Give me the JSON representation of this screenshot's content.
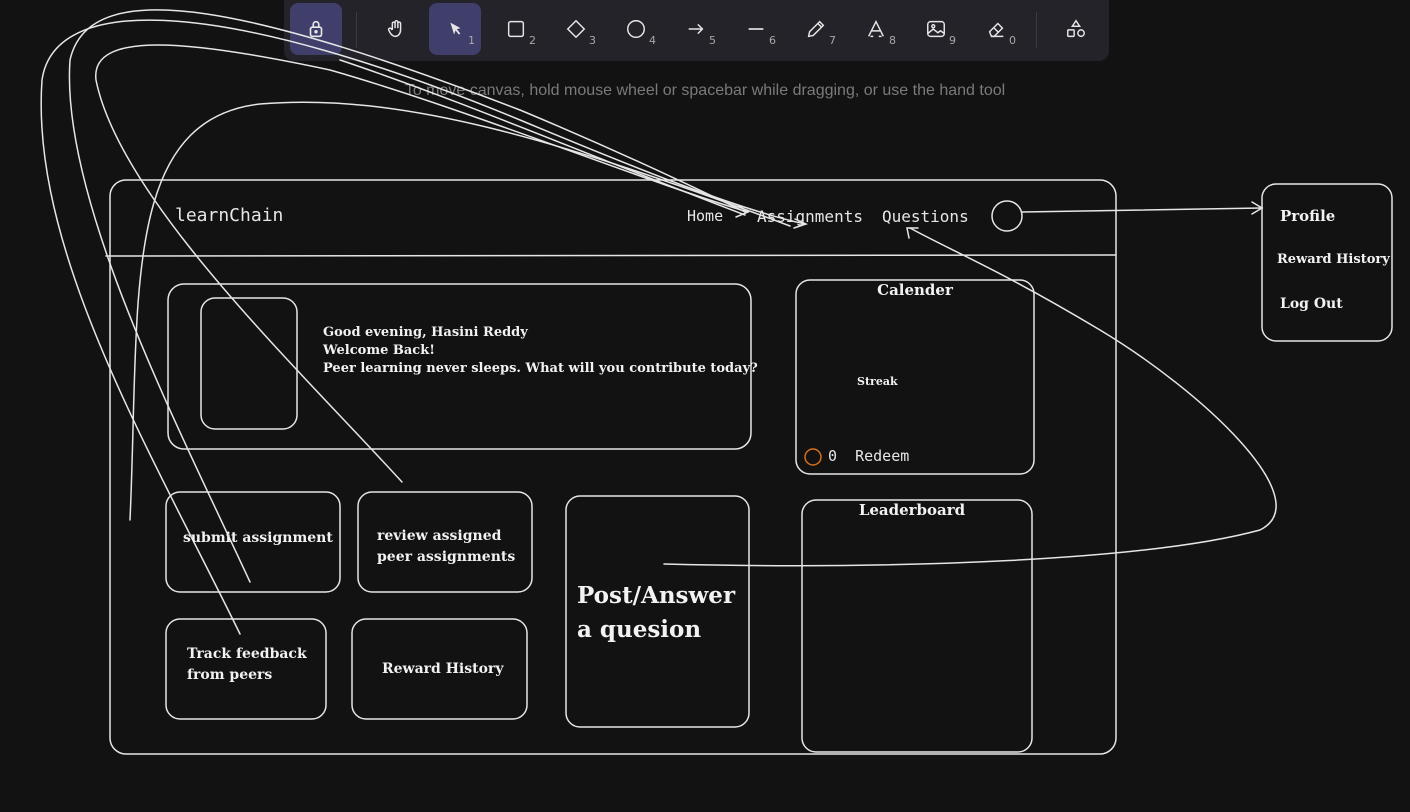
{
  "toolbar": {
    "tools": [
      {
        "name": "lock",
        "key": ""
      },
      {
        "name": "hand",
        "key": ""
      },
      {
        "name": "selection",
        "key": "1"
      },
      {
        "name": "rectangle",
        "key": "2"
      },
      {
        "name": "diamond",
        "key": "3"
      },
      {
        "name": "ellipse",
        "key": "4"
      },
      {
        "name": "arrow",
        "key": "5"
      },
      {
        "name": "line",
        "key": "6"
      },
      {
        "name": "pencil",
        "key": "7"
      },
      {
        "name": "text",
        "key": "8"
      },
      {
        "name": "image",
        "key": "9"
      },
      {
        "name": "eraser",
        "key": "0"
      },
      {
        "name": "more-shapes",
        "key": ""
      }
    ],
    "active": [
      "lock",
      "selection"
    ]
  },
  "hint": "To move canvas, hold mouse wheel or spacebar while dragging, or use the hand tool",
  "mockup": {
    "logo": "learnChain",
    "nav": {
      "home": "Home",
      "assignments": "Assignments",
      "questions": "Questions"
    },
    "greeting": {
      "line1": "Good evening, Hasini Reddy",
      "line2": "Welcome Back!",
      "line3": "Peer learning never sleeps. What will you contribute today?"
    },
    "calendar": {
      "title": "Calender",
      "streak": "Streak",
      "redeem": "0  Redeem"
    },
    "cards": {
      "submit": "submit assignment",
      "review_line1": "review assigned",
      "review_line2": "peer assignments",
      "track_line1": "Track feedback",
      "track_line2": "from peers",
      "reward": "Reward History",
      "post_line1": "Post/Answer",
      "post_line2": "a quesion"
    },
    "leaderboard": {
      "title": "Leaderboard"
    },
    "profile_menu": {
      "profile": "Profile",
      "reward": "Reward History",
      "logout": "Log Out"
    }
  },
  "colors": {
    "accent": "#403e6a",
    "stroke": "#e6e6e6",
    "coin": "#d4701a",
    "bg": "#121212"
  }
}
